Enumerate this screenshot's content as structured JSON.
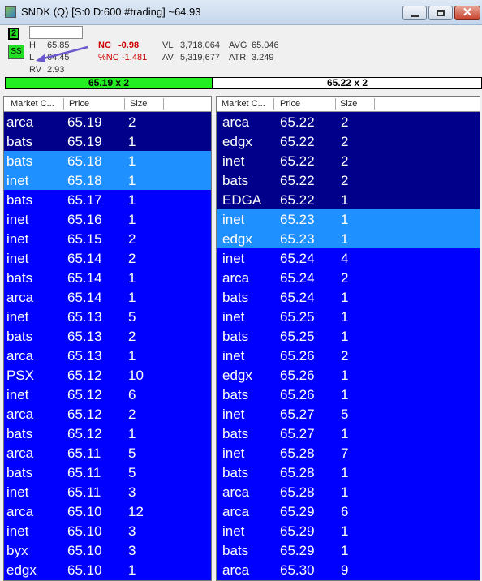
{
  "window": {
    "title": "SNDK (Q)  [S:0 D:600 #trading] ~64.93",
    "close_glyph": "✕"
  },
  "info": {
    "level_badge": "2",
    "ss_badge": "SS",
    "symbol_input": "",
    "h_label": "H",
    "h_value": "65.85",
    "l_label": "L",
    "l_value": "64.45",
    "rv_label": "RV",
    "rv_value": "2.93",
    "nc_label": "NC",
    "nc_value": "-0.98",
    "pnc_label": "%NC",
    "pnc_value": "-1.481",
    "vl_label": "VL",
    "vl_value": "3,718,064",
    "av_label": "AV",
    "av_value": "5,319,677",
    "avg_label": "AVG",
    "avg_value": "65.046",
    "atr_label": "ATR",
    "atr_value": "3.249"
  },
  "quote": {
    "bid": "65.19  x  2",
    "ask": "65.22  x  2"
  },
  "colors": {
    "row_default": "#0000ff",
    "level_1": "#00008b",
    "level_2": "#1e90ff",
    "accent_green": "#22ee22",
    "negative_red": "#cc0000"
  },
  "columns": [
    "Market C...",
    "Price",
    "Size"
  ],
  "bids": [
    {
      "mm": "arca",
      "price": "65.19",
      "size": "2",
      "level": 1
    },
    {
      "mm": "bats",
      "price": "65.19",
      "size": "1",
      "level": 1
    },
    {
      "mm": "bats",
      "price": "65.18",
      "size": "1",
      "level": 2
    },
    {
      "mm": "inet",
      "price": "65.18",
      "size": "1",
      "level": 2
    },
    {
      "mm": "bats",
      "price": "65.17",
      "size": "1",
      "level": 0
    },
    {
      "mm": "inet",
      "price": "65.16",
      "size": "1",
      "level": 0
    },
    {
      "mm": "inet",
      "price": "65.15",
      "size": "2",
      "level": 0
    },
    {
      "mm": "inet",
      "price": "65.14",
      "size": "2",
      "level": 0
    },
    {
      "mm": "bats",
      "price": "65.14",
      "size": "1",
      "level": 0
    },
    {
      "mm": "arca",
      "price": "65.14",
      "size": "1",
      "level": 0
    },
    {
      "mm": "inet",
      "price": "65.13",
      "size": "5",
      "level": 0
    },
    {
      "mm": "bats",
      "price": "65.13",
      "size": "2",
      "level": 0
    },
    {
      "mm": "arca",
      "price": "65.13",
      "size": "1",
      "level": 0
    },
    {
      "mm": "PSX",
      "price": "65.12",
      "size": "10",
      "level": 0
    },
    {
      "mm": "inet",
      "price": "65.12",
      "size": "6",
      "level": 0
    },
    {
      "mm": "arca",
      "price": "65.12",
      "size": "2",
      "level": 0
    },
    {
      "mm": "bats",
      "price": "65.12",
      "size": "1",
      "level": 0
    },
    {
      "mm": "arca",
      "price": "65.11",
      "size": "5",
      "level": 0
    },
    {
      "mm": "bats",
      "price": "65.11",
      "size": "5",
      "level": 0
    },
    {
      "mm": "inet",
      "price": "65.11",
      "size": "3",
      "level": 0
    },
    {
      "mm": "arca",
      "price": "65.10",
      "size": "12",
      "level": 0
    },
    {
      "mm": "inet",
      "price": "65.10",
      "size": "3",
      "level": 0
    },
    {
      "mm": "byx",
      "price": "65.10",
      "size": "3",
      "level": 0
    },
    {
      "mm": "edgx",
      "price": "65.10",
      "size": "1",
      "level": 0
    }
  ],
  "asks": [
    {
      "mm": "arca",
      "price": "65.22",
      "size": "2",
      "level": 1
    },
    {
      "mm": "edgx",
      "price": "65.22",
      "size": "2",
      "level": 1
    },
    {
      "mm": "inet",
      "price": "65.22",
      "size": "2",
      "level": 1
    },
    {
      "mm": "bats",
      "price": "65.22",
      "size": "2",
      "level": 1
    },
    {
      "mm": "EDGA",
      "price": "65.22",
      "size": "1",
      "level": 1
    },
    {
      "mm": "inet",
      "price": "65.23",
      "size": "1",
      "level": 2
    },
    {
      "mm": "edgx",
      "price": "65.23",
      "size": "1",
      "level": 2
    },
    {
      "mm": "inet",
      "price": "65.24",
      "size": "4",
      "level": 0
    },
    {
      "mm": "arca",
      "price": "65.24",
      "size": "2",
      "level": 0
    },
    {
      "mm": "bats",
      "price": "65.24",
      "size": "1",
      "level": 0
    },
    {
      "mm": "inet",
      "price": "65.25",
      "size": "1",
      "level": 0
    },
    {
      "mm": "bats",
      "price": "65.25",
      "size": "1",
      "level": 0
    },
    {
      "mm": "inet",
      "price": "65.26",
      "size": "2",
      "level": 0
    },
    {
      "mm": "edgx",
      "price": "65.26",
      "size": "1",
      "level": 0
    },
    {
      "mm": "bats",
      "price": "65.26",
      "size": "1",
      "level": 0
    },
    {
      "mm": "inet",
      "price": "65.27",
      "size": "5",
      "level": 0
    },
    {
      "mm": "bats",
      "price": "65.27",
      "size": "1",
      "level": 0
    },
    {
      "mm": "inet",
      "price": "65.28",
      "size": "7",
      "level": 0
    },
    {
      "mm": "bats",
      "price": "65.28",
      "size": "1",
      "level": 0
    },
    {
      "mm": "arca",
      "price": "65.28",
      "size": "1",
      "level": 0
    },
    {
      "mm": "arca",
      "price": "65.29",
      "size": "6",
      "level": 0
    },
    {
      "mm": "inet",
      "price": "65.29",
      "size": "1",
      "level": 0
    },
    {
      "mm": "bats",
      "price": "65.29",
      "size": "1",
      "level": 0
    },
    {
      "mm": "arca",
      "price": "65.30",
      "size": "9",
      "level": 0
    }
  ]
}
